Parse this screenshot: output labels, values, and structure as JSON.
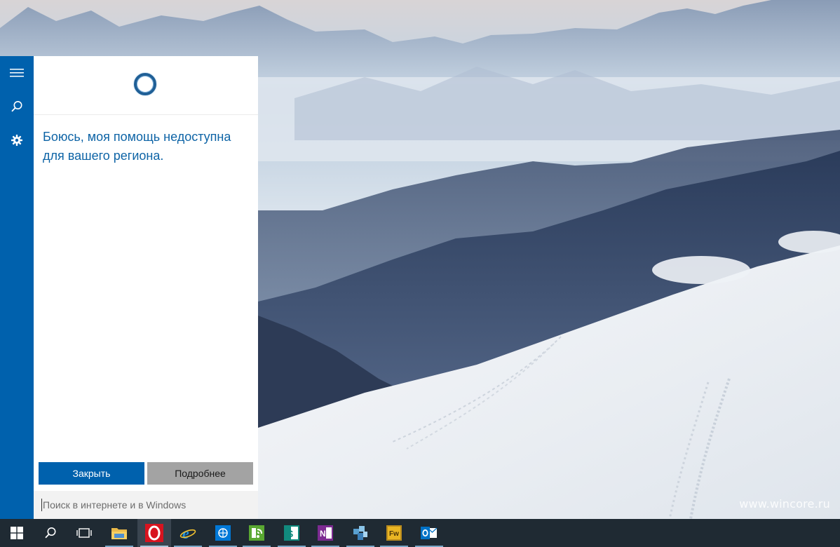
{
  "cortana": {
    "message": "Боюсь, моя помощь недоступна для вашего региона.",
    "close_label": "Закрыть",
    "more_label": "Подробнее",
    "search_placeholder": "Поиск в интернете и в Windows"
  },
  "rail": {
    "icons": [
      "hamburger-menu-icon",
      "search-icon",
      "settings-gear-icon"
    ]
  },
  "taskbar": {
    "items": [
      "start-icon",
      "search-icon",
      "task-view-icon",
      "file-explorer-icon",
      "opera-icon",
      "internet-explorer-icon",
      "windows-app-icon",
      "feed-reader-icon",
      "sway-icon",
      "onenote-icon",
      "puzzle-app-icon",
      "fireworks-icon",
      "outlook-icon"
    ]
  },
  "watermark": "www.wincore.ru",
  "colors": {
    "accent": "#0061ad",
    "message_text": "#0e64a6",
    "taskbar": "#1f2a33"
  }
}
